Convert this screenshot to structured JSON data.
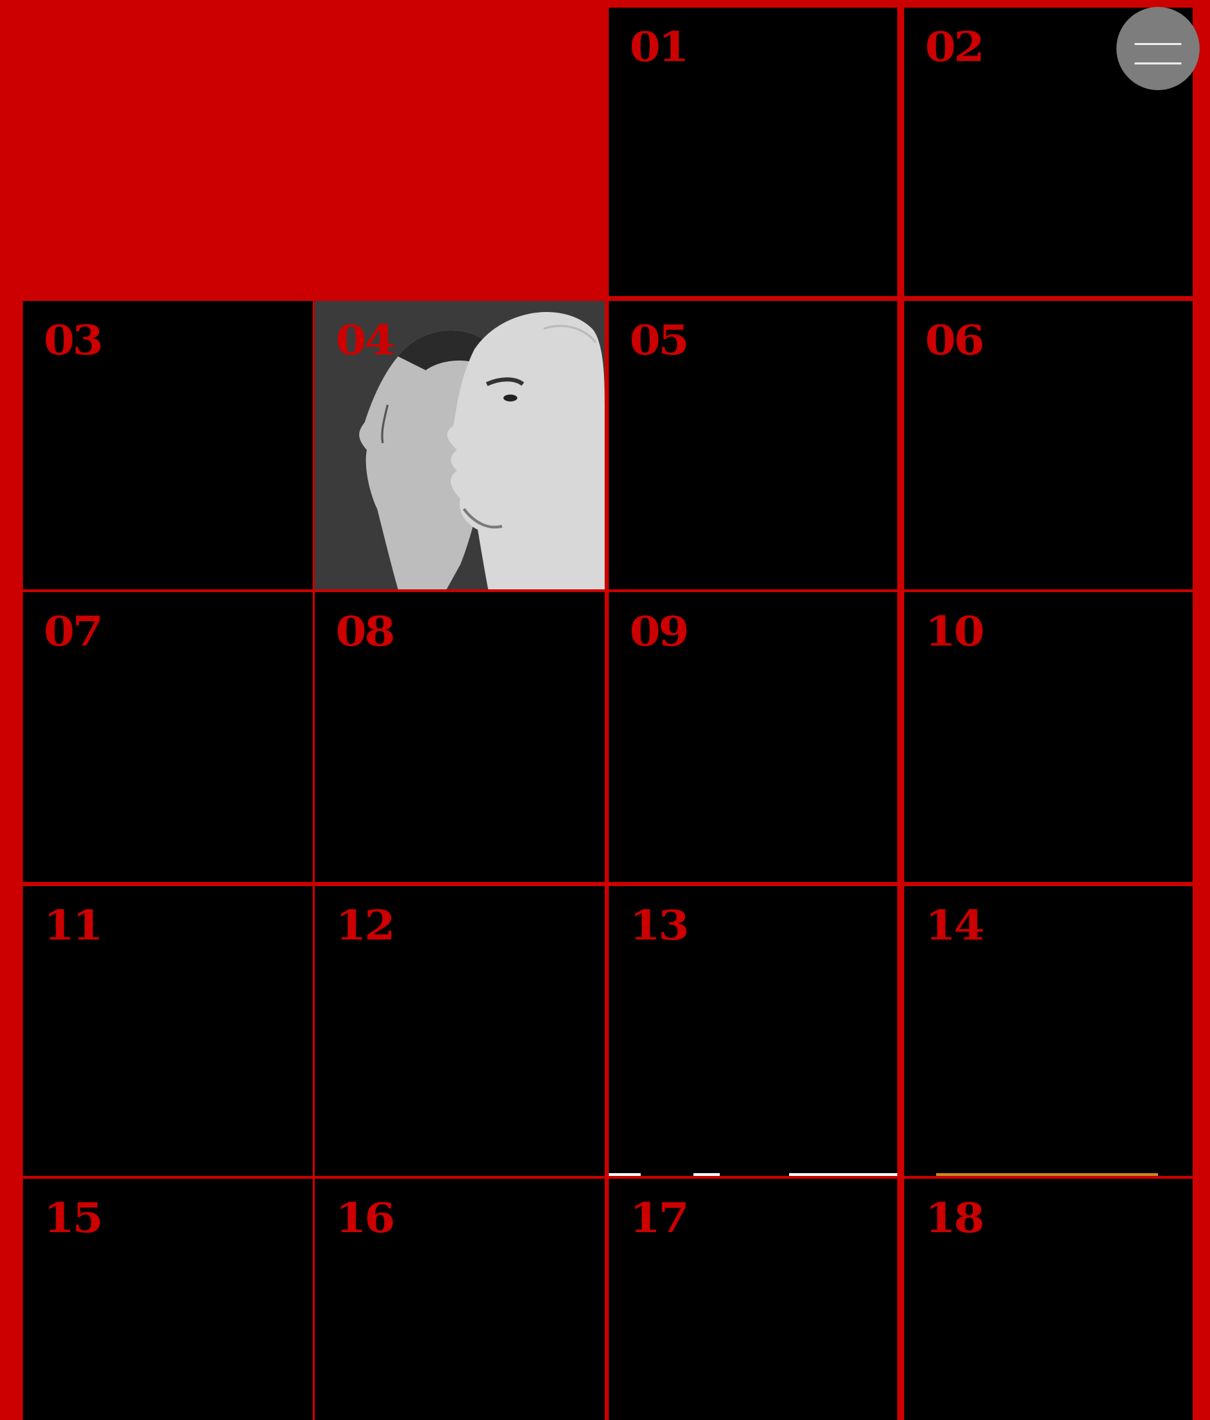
{
  "colors": {
    "background": "#cc0000",
    "tile": "#000000",
    "number": "#cc0000",
    "menu_button": "#7d7d7d",
    "menu_lines": "#e9e9e9"
  },
  "menu": {
    "icon": "hamburger-menu-icon"
  },
  "tiles": [
    {
      "number": "01"
    },
    {
      "number": "02"
    },
    {
      "number": "03"
    },
    {
      "number": "04",
      "image": "black-and-white portrait of two men in profile"
    },
    {
      "number": "05"
    },
    {
      "number": "06"
    },
    {
      "number": "07"
    },
    {
      "number": "08"
    },
    {
      "number": "09"
    },
    {
      "number": "10"
    },
    {
      "number": "11"
    },
    {
      "number": "12"
    },
    {
      "number": "13"
    },
    {
      "number": "14"
    },
    {
      "number": "15"
    },
    {
      "number": "16"
    },
    {
      "number": "17"
    },
    {
      "number": "18"
    }
  ]
}
